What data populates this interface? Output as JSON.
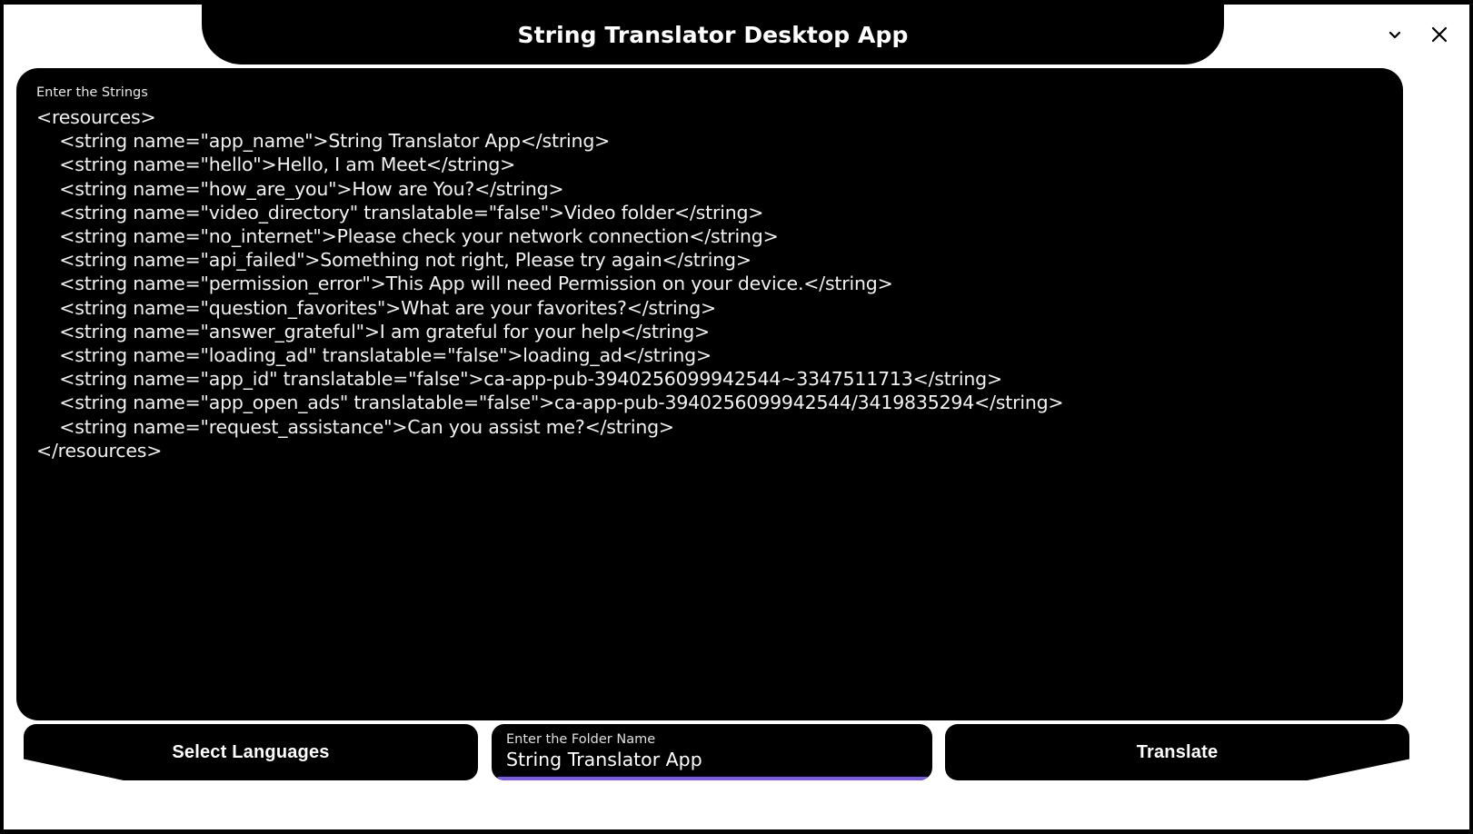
{
  "window": {
    "title": "String Translator Desktop App",
    "controls": [
      {
        "name": "minimize",
        "glyph": "chevron-down"
      },
      {
        "name": "close",
        "glyph": "x"
      }
    ]
  },
  "strings_editor": {
    "label": "Enter the Strings",
    "content": "<resources>\n    <string name=\"app_name\">String Translator App</string>\n    <string name=\"hello\">Hello, I am Meet</string>\n    <string name=\"how_are_you\">How are You?</string>\n    <string name=\"video_directory\" translatable=\"false\">Video folder</string>\n    <string name=\"no_internet\">Please check your network connection</string>\n    <string name=\"api_failed\">Something not right, Please try again</string>\n    <string name=\"permission_error\">This App will need Permission on your device.</string>\n    <string name=\"question_favorites\">What are your favorites?</string>\n    <string name=\"answer_grateful\">I am grateful for your help</string>\n    <string name=\"loading_ad\" translatable=\"false\">loading_ad</string>\n    <string name=\"app_id\" translatable=\"false\">ca-app-pub-3940256099942544~3347511713</string>\n    <string name=\"app_open_ads\" translatable=\"false\">ca-app-pub-3940256099942544/3419835294</string>\n    <string name=\"request_assistance\">Can you assist me?</string>\n</resources>"
  },
  "footer": {
    "select_languages_label": "Select Languages",
    "folder_field": {
      "label": "Enter the Folder Name",
      "value": "String Translator App",
      "placeholder": "Enter the Folder Name",
      "accent_color": "#7e57f0"
    },
    "translate_label": "Translate"
  },
  "colors": {
    "background": "#ffffff",
    "panel": "#000000",
    "text_on_panel": "#ffffff",
    "accent": "#7e57f0"
  }
}
